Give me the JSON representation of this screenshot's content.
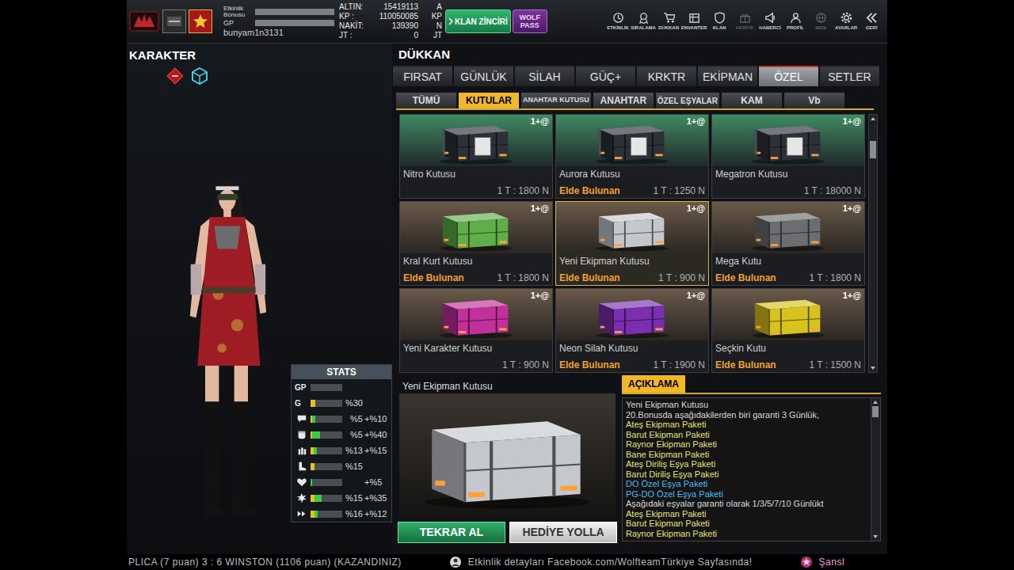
{
  "top_bar": {
    "bonus_label": "Etkinlik Bonusu",
    "bonus_level": 0,
    "gp_label": "GP",
    "gp_level": 0,
    "username": "bunyam1n3131",
    "currencies": [
      {
        "label": "ALTIN:",
        "value": "15419113",
        "unit": "A"
      },
      {
        "label": "KP :",
        "value": "110050085",
        "unit": "KP"
      },
      {
        "label": "NAKİT:",
        "value": "139390",
        "unit": "N"
      },
      {
        "label": "JT :",
        "value": "0",
        "unit": "JT"
      }
    ],
    "klan_button": "KLAN ZİNCİRİ",
    "pass_button": "WOLF PASS",
    "nav": [
      {
        "label": "ETKİNLİK",
        "disabled": false
      },
      {
        "label": "SIRALAMA",
        "disabled": false
      },
      {
        "label": "DÜKKAN",
        "disabled": false
      },
      {
        "label": "ENVANTER",
        "disabled": false
      },
      {
        "label": "KLAN",
        "disabled": false
      },
      {
        "label": "HEDİYE",
        "disabled": true
      },
      {
        "label": "HABERCİ",
        "disabled": false
      },
      {
        "label": "PROFİL",
        "disabled": false
      },
      {
        "label": "WEB",
        "disabled": true
      },
      {
        "label": "AYARLAR",
        "disabled": false
      },
      {
        "label": "GERİ",
        "disabled": false
      }
    ]
  },
  "character": {
    "title": "KARAKTER"
  },
  "stats": {
    "title": "STATS",
    "rows": [
      {
        "kind": "text",
        "label": "GP",
        "level": 0,
        "bonus_level": 0
      },
      {
        "kind": "text",
        "label": "G",
        "base": "%30",
        "level": 0.15,
        "bonus_level": 0
      },
      {
        "kind": "icon",
        "base": "%5",
        "bonus": "+%10",
        "level": 0.06,
        "bonus_level": 0.08
      },
      {
        "kind": "icon",
        "base": "%5",
        "bonus": "+%40",
        "level": 0.06,
        "bonus_level": 0.25
      },
      {
        "kind": "icon",
        "base": "%13",
        "bonus": "+%15",
        "level": 0.1,
        "bonus_level": 0.1
      },
      {
        "kind": "icon",
        "base": "%15",
        "level": 0.13,
        "bonus_level": 0
      },
      {
        "kind": "icon",
        "bonus": "+%5",
        "level": 0,
        "bonus_level": 0.05
      },
      {
        "kind": "icon",
        "base": "%15",
        "bonus": "+%35",
        "level": 0.12,
        "bonus_level": 0.22
      },
      {
        "kind": "icon",
        "base": "%16",
        "bonus": "+%12",
        "level": 0.12,
        "bonus_level": 0.1
      }
    ]
  },
  "shop": {
    "title": "DÜKKAN",
    "tabs": [
      {
        "label": "FIRSAT",
        "selected": false
      },
      {
        "label": "GÜNLÜK",
        "selected": false
      },
      {
        "label": "SİLAH",
        "selected": false
      },
      {
        "label": "GÜÇ+",
        "selected": false
      },
      {
        "label": "KRKTR",
        "selected": false
      },
      {
        "label": "EKİPMAN",
        "selected": false
      },
      {
        "label": "ÖZEL",
        "selected": true
      },
      {
        "label": "SETLER",
        "selected": false
      }
    ],
    "subtabs": [
      {
        "label": "TÜMÜ",
        "selected": false
      },
      {
        "label": "KUTULAR",
        "selected": true
      },
      {
        "label": "ANAHTAR KUTUSU",
        "selected": false
      },
      {
        "label": "ANAHTAR",
        "selected": false
      },
      {
        "label": "ÖZEL EŞYALAR",
        "selected": false
      },
      {
        "label": "KAM",
        "selected": false
      },
      {
        "label": "Vb",
        "selected": false
      }
    ],
    "owned_label": "Elde Bulunan",
    "items": [
      {
        "name": "Nitro Kutusu",
        "badge": "1+@",
        "price": "1 T : 1800 N",
        "owned": false,
        "selected": false,
        "kind": "crate",
        "color": "#2c3038"
      },
      {
        "name": "Aurora Kutusu",
        "badge": "1+@",
        "price": "1 T : 1250 N",
        "owned": true,
        "selected": false,
        "kind": "crate",
        "color": "#2c3038"
      },
      {
        "name": "Megatron Kutusu",
        "badge": "1+@",
        "price": "1 T : 18000 N",
        "owned": false,
        "selected": false,
        "kind": "crate",
        "color": "#2c3038"
      },
      {
        "name": "Kral Kurt Kutusu",
        "badge": "1+@",
        "price": "1 T : 1800 N",
        "owned": true,
        "selected": false,
        "kind": "box",
        "color": "#5fae4a"
      },
      {
        "name": "Yeni Ekipman Kutusu",
        "badge": "1+@",
        "price": "1 T : 900 N",
        "owned": true,
        "selected": true,
        "kind": "box",
        "color": "#c4c7cb"
      },
      {
        "name": "Mega Kutu",
        "badge": "1+@",
        "price": "1 T : 1800 N",
        "owned": true,
        "selected": false,
        "kind": "box",
        "color": "#6b6d70"
      },
      {
        "name": "Yeni Karakter Kutusu",
        "badge": "1+@",
        "price": "1 T : 900 N",
        "owned": false,
        "selected": false,
        "kind": "box",
        "color": "#c2309c"
      },
      {
        "name": "Neon Silah Kutusu",
        "badge": "1+@",
        "price": "1 T : 1900 N",
        "owned": true,
        "selected": false,
        "kind": "box",
        "color": "#7a2fb0"
      },
      {
        "name": "Seçkin Kutu",
        "badge": "1+@",
        "price": "1 T : 1500 N",
        "owned": true,
        "selected": false,
        "kind": "box",
        "color": "#d8c21e"
      }
    ],
    "scroll_level": 0.08,
    "detail": {
      "title": "Yeni Ekipman Kutusu",
      "kind": "box",
      "color": "#c4c7cb"
    },
    "description": {
      "title": "AÇIKLAMA",
      "scroll_level": 0,
      "lines": [
        {
          "text": "Yeni Ekipman Kutusu",
          "color": "#d8d8d8"
        },
        {
          "text": "20.Bonusda aşağıdakilerden biri garanti 3 Günlük,",
          "color": "#d8d8d8"
        },
        {
          "text": "Ateş Ekipman Paketi",
          "color": "#e6e27a"
        },
        {
          "text": "Barut Ekipman Paketi",
          "color": "#e6e27a"
        },
        {
          "text": "Raynor Ekipman Paketi",
          "color": "#e6e27a"
        },
        {
          "text": "Bane Ekipman Paketi",
          "color": "#e6e27a"
        },
        {
          "text": "Ateş Diriliş Eşya Paketi",
          "color": "#e6e27a"
        },
        {
          "text": "Barut Diriliş Eşya Paketi",
          "color": "#e6e27a"
        },
        {
          "text": "DO Özel Eşya Paketi",
          "color": "#4cb8f0"
        },
        {
          "text": "PG-DO Özel Eşya Paketi",
          "color": "#4cb8f0"
        },
        {
          "text": "Aşağıdaki eşyalar garanti olarak 1/3/5/7/10 Günlükt",
          "color": "#d8d8d8"
        },
        {
          "text": "Ateş Ekipman Paketi",
          "color": "#e6e27a"
        },
        {
          "text": "Barut Ekipman Paketi",
          "color": "#e6e27a"
        },
        {
          "text": "Raynor Ekipman Paketi",
          "color": "#e6e27a"
        }
      ]
    },
    "buttons": [
      "TEKRAR AL",
      "HEDİYE YOLLA"
    ]
  },
  "ticker": {
    "match": "PLICA (7 puan) 3 : 6 WINSTON (1106 puan) (KAZANDINIZ)",
    "event": "Etkinlik detayları Facebook.com/WolfteamTürkiye Sayfasında!",
    "trail": "Şansl"
  }
}
